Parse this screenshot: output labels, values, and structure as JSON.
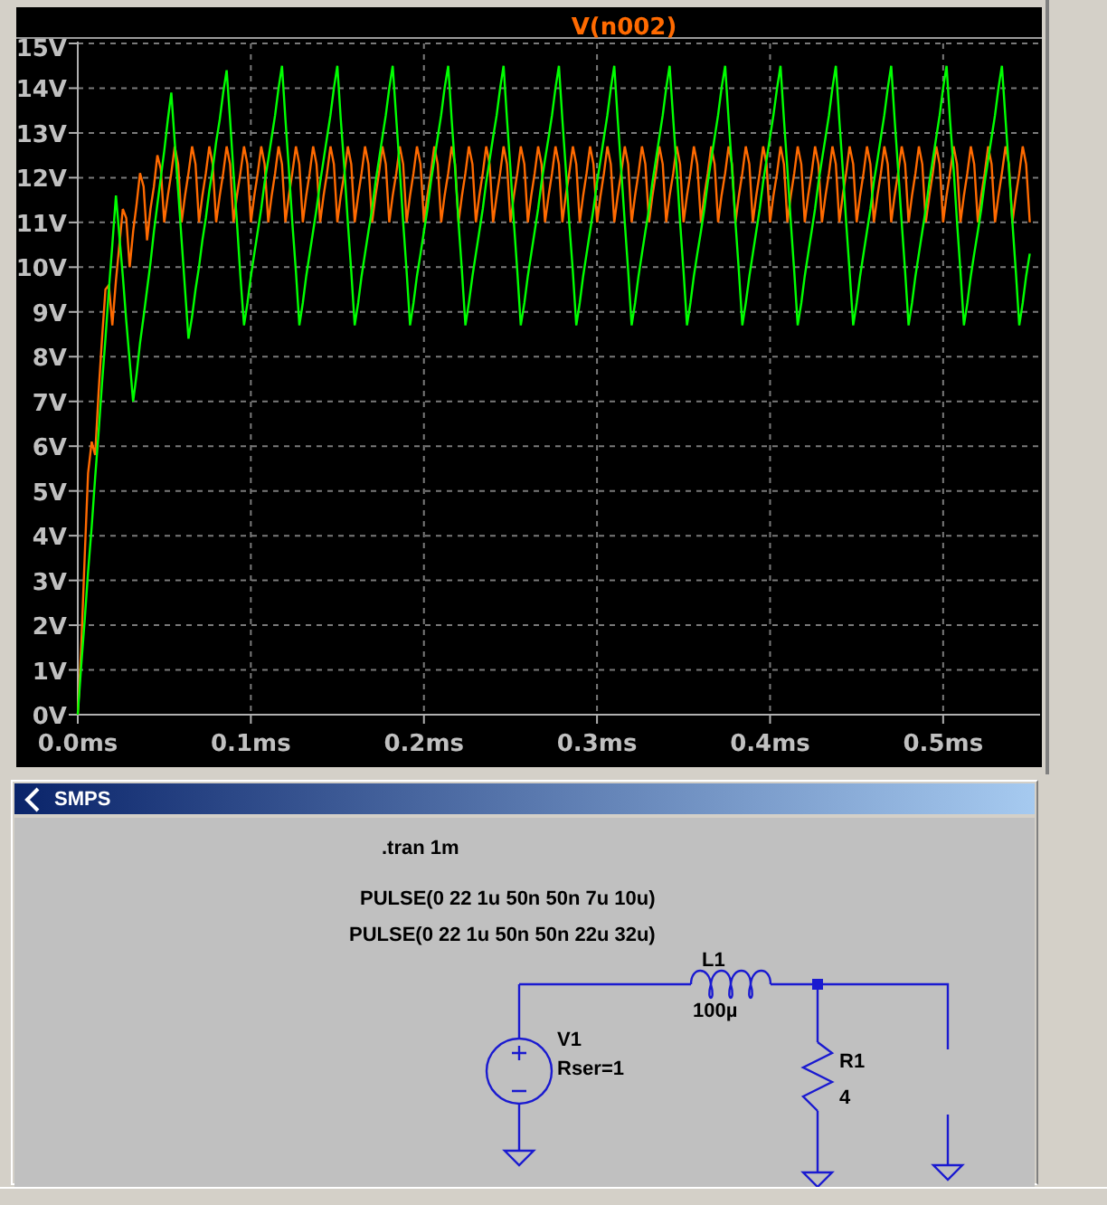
{
  "plot_window": {
    "chart_data": {
      "type": "line",
      "grid": true,
      "xlim": [
        0,
        0.556
      ],
      "ylim": [
        0,
        15
      ],
      "xticks": [
        {
          "value": 0,
          "label": "0.0ms"
        },
        {
          "value": 0.1,
          "label": "0.1ms"
        },
        {
          "value": 0.2,
          "label": "0.2ms"
        },
        {
          "value": 0.3,
          "label": "0.3ms"
        },
        {
          "value": 0.4,
          "label": "0.4ms"
        },
        {
          "value": 0.5,
          "label": "0.5ms"
        }
      ],
      "yticks": [
        {
          "value": 0,
          "label": "0V"
        },
        {
          "value": 1,
          "label": "1V"
        },
        {
          "value": 2,
          "label": "2V"
        },
        {
          "value": 3,
          "label": "3V"
        },
        {
          "value": 4,
          "label": "4V"
        },
        {
          "value": 5,
          "label": "5V"
        },
        {
          "value": 6,
          "label": "6V"
        },
        {
          "value": 7,
          "label": "7V"
        },
        {
          "value": 8,
          "label": "8V"
        },
        {
          "value": 9,
          "label": "9V"
        },
        {
          "value": 10,
          "label": "10V"
        },
        {
          "value": 11,
          "label": "11V"
        },
        {
          "value": 12,
          "label": "12V"
        },
        {
          "value": 13,
          "label": "13V"
        },
        {
          "value": 14,
          "label": "14V"
        },
        {
          "value": 15,
          "label": "15V"
        }
      ],
      "x": [
        0,
        0.002,
        0.004,
        0.006,
        0.008,
        0.01,
        0.012,
        0.014,
        0.016,
        0.018,
        0.02,
        0.022,
        0.024,
        0.026,
        0.028,
        0.03,
        0.032,
        0.034,
        0.036,
        0.038,
        0.04,
        0.042,
        0.044,
        0.046,
        0.048,
        0.05,
        0.052,
        0.054,
        0.056,
        0.058,
        0.06,
        0.062,
        0.064,
        0.066,
        0.068,
        0.07,
        0.072,
        0.074,
        0.076,
        0.078,
        0.08,
        0.082,
        0.084,
        0.086,
        0.088,
        0.09,
        0.092,
        0.094,
        0.096,
        0.098,
        0.1,
        0.102,
        0.104,
        0.106,
        0.108,
        0.11,
        0.112,
        0.114,
        0.116,
        0.118,
        0.12,
        0.122,
        0.124,
        0.126,
        0.128,
        0.13,
        0.132,
        0.134,
        0.136,
        0.138,
        0.14,
        0.142,
        0.144,
        0.146,
        0.148,
        0.15,
        0.152,
        0.154,
        0.156,
        0.158,
        0.16,
        0.162,
        0.164,
        0.166,
        0.168,
        0.17,
        0.172,
        0.174,
        0.176,
        0.178,
        0.18,
        0.182,
        0.184,
        0.186,
        0.188,
        0.19,
        0.192,
        0.194,
        0.196,
        0.198,
        0.2,
        0.202,
        0.204,
        0.206,
        0.208,
        0.21,
        0.212,
        0.214,
        0.216,
        0.218,
        0.22,
        0.222,
        0.224,
        0.226,
        0.228,
        0.23,
        0.232,
        0.234,
        0.236,
        0.238,
        0.24,
        0.242,
        0.244,
        0.246,
        0.248,
        0.25,
        0.252,
        0.254,
        0.256,
        0.258,
        0.26,
        0.262,
        0.264,
        0.266,
        0.268,
        0.27,
        0.272,
        0.274,
        0.276,
        0.278,
        0.28,
        0.282,
        0.284,
        0.286,
        0.288,
        0.29,
        0.292,
        0.294,
        0.296,
        0.298,
        0.3,
        0.302,
        0.304,
        0.306,
        0.308,
        0.31,
        0.312,
        0.314,
        0.316,
        0.318,
        0.32,
        0.322,
        0.324,
        0.326,
        0.328,
        0.33,
        0.332,
        0.334,
        0.336,
        0.338,
        0.34,
        0.342,
        0.344,
        0.346,
        0.348,
        0.35,
        0.352,
        0.354,
        0.356,
        0.358,
        0.36,
        0.362,
        0.364,
        0.366,
        0.368,
        0.37,
        0.372,
        0.374,
        0.376,
        0.378,
        0.38,
        0.382,
        0.384,
        0.386,
        0.388,
        0.39,
        0.392,
        0.394,
        0.396,
        0.398,
        0.4,
        0.402,
        0.404,
        0.406,
        0.408,
        0.41,
        0.412,
        0.414,
        0.416,
        0.418,
        0.42,
        0.422,
        0.424,
        0.426,
        0.428,
        0.43,
        0.432,
        0.434,
        0.436,
        0.438,
        0.44,
        0.442,
        0.444,
        0.446,
        0.448,
        0.45,
        0.452,
        0.454,
        0.456,
        0.458,
        0.46,
        0.462,
        0.464,
        0.466,
        0.468,
        0.47,
        0.472,
        0.474,
        0.476,
        0.478,
        0.48,
        0.482,
        0.484,
        0.486,
        0.488,
        0.49,
        0.492,
        0.494,
        0.496,
        0.498,
        0.5,
        0.502,
        0.504,
        0.506,
        0.508,
        0.51,
        0.512,
        0.514,
        0.516,
        0.518,
        0.52,
        0.522,
        0.524,
        0.526,
        0.528,
        0.53,
        0.532,
        0.534,
        0.536,
        0.538,
        0.54,
        0.542,
        0.544,
        0.546,
        0.548,
        0.55
      ],
      "series": [
        {
          "name": "V(n002)",
          "color": "#ff6a00",
          "values": [
            0,
            1.5,
            3.5,
            5.4,
            6.1,
            5.8,
            7.2,
            8.4,
            9.5,
            9.6,
            8.7,
            9.7,
            10.5,
            11.3,
            11.1,
            10,
            10.8,
            11.4,
            12.1,
            11.8,
            10.6,
            11.3,
            11.8,
            12.5,
            12.2,
            11,
            11.6,
            12.1,
            12.7,
            12.3,
            11,
            11.6,
            12.1,
            12.7,
            12.3,
            11,
            11.6,
            12.1,
            12.7,
            12.3,
            11,
            11.6,
            12.1,
            12.7,
            12.3,
            11,
            11.6,
            12.1,
            12.7,
            12.3,
            11,
            11.6,
            12.1,
            12.7,
            12.3,
            11,
            11.6,
            12.1,
            12.7,
            12.3,
            11,
            11.6,
            12.1,
            12.7,
            12.3,
            11,
            11.6,
            12.1,
            12.7,
            12.3,
            11,
            11.6,
            12.1,
            12.7,
            12.3,
            11,
            11.6,
            12.1,
            12.7,
            12.3,
            11,
            11.6,
            12.1,
            12.7,
            12.3,
            11,
            11.6,
            12.1,
            12.7,
            12.3,
            11,
            11.6,
            12.1,
            12.7,
            12.3,
            11,
            11.6,
            12.1,
            12.7,
            12.3,
            11,
            11.6,
            12.1,
            12.7,
            12.3,
            11,
            11.6,
            12.1,
            12.7,
            12.3,
            11,
            11.6,
            12.1,
            12.7,
            12.3,
            11,
            11.6,
            12.1,
            12.7,
            12.3,
            11,
            11.6,
            12.1,
            12.7,
            12.3,
            11,
            11.6,
            12.1,
            12.7,
            12.3,
            11,
            11.6,
            12.1,
            12.7,
            12.3,
            11,
            11.6,
            12.1,
            12.7,
            12.3,
            11,
            11.6,
            12.1,
            12.7,
            12.3,
            11,
            11.6,
            12.1,
            12.7,
            12.3,
            11,
            11.6,
            12.1,
            12.7,
            12.3,
            11,
            11.6,
            12.1,
            12.7,
            12.3,
            11,
            11.6,
            12.1,
            12.7,
            12.3,
            11,
            11.6,
            12.1,
            12.7,
            12.3,
            11,
            11.6,
            12.1,
            12.7,
            12.3,
            11,
            11.6,
            12.1,
            12.7,
            12.3,
            11,
            11.6,
            12.1,
            12.7,
            12.3,
            11,
            11.6,
            12.1,
            12.7,
            12.3,
            11,
            11.6,
            12.1,
            12.7,
            12.3,
            11,
            11.6,
            12.1,
            12.7,
            12.3,
            11,
            11.6,
            12.1,
            12.7,
            12.3,
            11,
            11.6,
            12.1,
            12.7,
            12.3,
            11,
            11.6,
            12.1,
            12.7,
            12.3,
            11,
            11.6,
            12.1,
            12.7,
            12.3,
            11,
            11.6,
            12.1,
            12.7,
            12.3,
            11,
            11.6,
            12.1,
            12.7,
            12.3,
            11,
            11.6,
            12.1,
            12.7,
            12.3,
            11,
            11.6,
            12.1,
            12.7,
            12.3,
            11,
            11.6,
            12.1,
            12.7,
            12.3,
            11,
            11.6,
            12.1,
            12.7,
            12.3,
            11,
            11.6,
            12.1,
            12.7,
            12.3,
            11,
            11.6,
            12.1,
            12.7,
            12.3,
            11,
            11.6,
            12.1,
            12.7,
            12.3,
            11,
            11.6,
            12.1,
            12.7,
            12.3,
            11,
            11.6,
            12.1,
            12.7,
            12.3,
            11
          ]
        },
        {
          "color": "#00ff00",
          "values": [
            0,
            1.1,
            2.1,
            3.2,
            4.2,
            5.3,
            6.3,
            7.4,
            8.4,
            9.5,
            10.5,
            11.6,
            10.7,
            9.8,
            8.8,
            7.9,
            7,
            7.6,
            8.3,
            8.9,
            9.5,
            10.1,
            10.8,
            11.4,
            12,
            12.6,
            13.3,
            13.9,
            12.8,
            11.7,
            10.6,
            9.5,
            8.4,
            8.9,
            9.5,
            10,
            10.6,
            11.1,
            11.7,
            12.2,
            12.8,
            13.3,
            13.9,
            14.4,
            13.3,
            12.1,
            11,
            9.8,
            8.7,
            9.2,
            9.8,
            10.3,
            10.8,
            11.3,
            11.9,
            12.4,
            12.9,
            13.4,
            14,
            14.5,
            13.3,
            12.2,
            11,
            9.9,
            8.7,
            9.2,
            9.8,
            10.3,
            10.8,
            11.3,
            11.9,
            12.4,
            12.9,
            13.4,
            14,
            14.5,
            13.3,
            12.2,
            11,
            9.9,
            8.7,
            9.2,
            9.8,
            10.3,
            10.8,
            11.3,
            11.9,
            12.4,
            12.9,
            13.4,
            14,
            14.5,
            13.3,
            12.2,
            11,
            9.9,
            8.7,
            9.2,
            9.8,
            10.3,
            10.8,
            11.3,
            11.9,
            12.4,
            12.9,
            13.4,
            14,
            14.5,
            13.3,
            12.2,
            11,
            9.9,
            8.7,
            9.2,
            9.8,
            10.3,
            10.8,
            11.3,
            11.9,
            12.4,
            12.9,
            13.4,
            14,
            14.5,
            13.3,
            12.2,
            11,
            9.9,
            8.7,
            9.2,
            9.8,
            10.3,
            10.8,
            11.3,
            11.9,
            12.4,
            12.9,
            13.4,
            14,
            14.5,
            13.3,
            12.2,
            11,
            9.9,
            8.7,
            9.2,
            9.8,
            10.3,
            10.8,
            11.3,
            11.9,
            12.4,
            12.9,
            13.4,
            14,
            14.5,
            13.3,
            12.2,
            11,
            9.9,
            8.7,
            9.2,
            9.8,
            10.3,
            10.8,
            11.3,
            11.9,
            12.4,
            12.9,
            13.4,
            14,
            14.5,
            13.3,
            12.2,
            11,
            9.9,
            8.7,
            9.2,
            9.8,
            10.3,
            10.8,
            11.3,
            11.9,
            12.4,
            12.9,
            13.4,
            14,
            14.5,
            13.3,
            12.2,
            11,
            9.9,
            8.7,
            9.2,
            9.8,
            10.3,
            10.8,
            11.3,
            11.9,
            12.4,
            12.9,
            13.4,
            14,
            14.5,
            13.3,
            12.2,
            11,
            9.9,
            8.7,
            9.2,
            9.8,
            10.3,
            10.8,
            11.3,
            11.9,
            12.4,
            12.9,
            13.4,
            14,
            14.5,
            13.3,
            12.2,
            11,
            9.9,
            8.7,
            9.2,
            9.8,
            10.3,
            10.8,
            11.3,
            11.9,
            12.4,
            12.9,
            13.4,
            14,
            14.5,
            13.3,
            12.2,
            11,
            9.9,
            8.7,
            9.2,
            9.8,
            10.3,
            10.8,
            11.3,
            11.9,
            12.4,
            12.9,
            13.4,
            14,
            14.5,
            13.3,
            12.2,
            11,
            9.9,
            8.7,
            9.2,
            9.8,
            10.3,
            10.8,
            11.3,
            11.9,
            12.4,
            12.9,
            13.4,
            14,
            14.5,
            13.3,
            12.2,
            11,
            9.9,
            8.7,
            9.2,
            9.8,
            10.3
          ]
        }
      ]
    }
  },
  "schematic_window": {
    "title": "SMPS",
    "directives": [
      ".tran 1m",
      "PULSE(0 22 1u 50n 50n 7u 10u)",
      "PULSE(0 22 1u 50n 50n 22u 32u)"
    ],
    "components": [
      {
        "kind": "inductor",
        "name": "L1",
        "value": "100µ"
      },
      {
        "kind": "voltage_source",
        "name": "V1",
        "value": "Rser=1"
      },
      {
        "kind": "resistor",
        "name": "R1",
        "value": "4"
      }
    ]
  }
}
